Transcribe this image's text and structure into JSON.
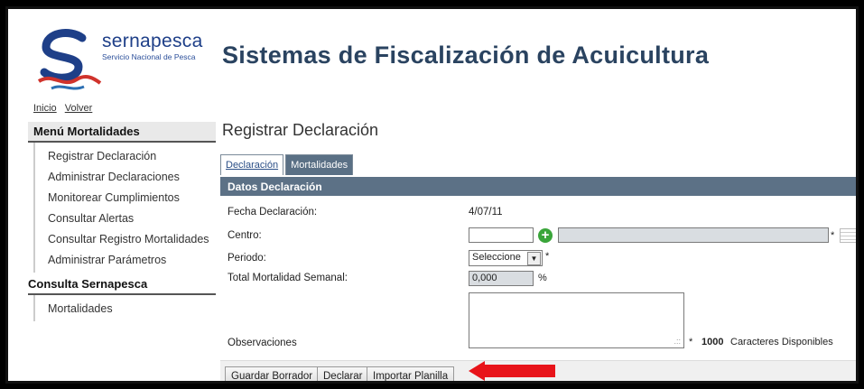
{
  "header": {
    "brand_name": "sernapesca",
    "brand_subtitle": "Servicio Nacional de Pesca",
    "app_title": "Sistemas de Fiscalización de Acuicultura"
  },
  "toplinks": {
    "inicio": "Inicio",
    "volver": "Volver"
  },
  "sidebar": {
    "menu_title": "Menú Mortalidades",
    "items": [
      {
        "label": "Registrar Declaración"
      },
      {
        "label": "Administrar Declaraciones"
      },
      {
        "label": "Monitorear Cumplimientos"
      },
      {
        "label": "Consultar Alertas"
      },
      {
        "label": "Consultar Registro Mortalidades"
      },
      {
        "label": "Administrar Parámetros"
      }
    ],
    "section2_title": "Consulta Sernapesca",
    "section2_items": [
      {
        "label": "Mortalidades"
      }
    ]
  },
  "main": {
    "page_title": "Registrar Declaración",
    "tabs": [
      {
        "label": "Declaración"
      },
      {
        "label": "Mortalidades"
      }
    ],
    "panel_title": "Datos Declaración",
    "fields": {
      "fecha_label": "Fecha Declaración:",
      "fecha_value": "4/07/11",
      "centro_label": "Centro:",
      "centro_value": "",
      "periodo_label": "Periodo:",
      "periodo_value": "Seleccione",
      "total_label": "Total Mortalidad Semanal:",
      "total_value": "0,000",
      "total_unit": "%",
      "obs_label": "Observaciones",
      "chars_count": "1000",
      "chars_text": "Caracteres Disponibles",
      "required_mark": "*"
    },
    "buttons": {
      "guardar": "Guardar Borrador",
      "declarar": "Declarar",
      "importar": "Importar Planilla"
    }
  },
  "colors": {
    "panel_header": "#5c7186",
    "arrow": "#e8141a",
    "add_icon": "#3aa53a"
  }
}
